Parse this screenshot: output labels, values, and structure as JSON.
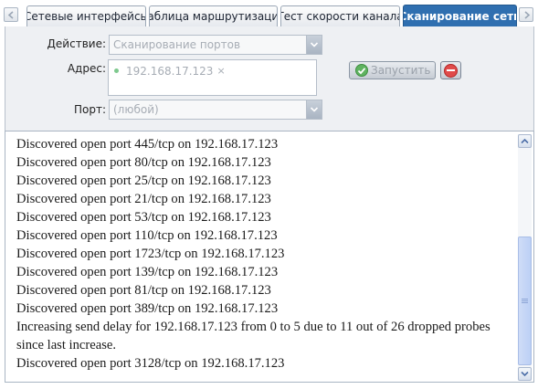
{
  "tabs": [
    {
      "label": "Сетевые интерфейсы",
      "active": false
    },
    {
      "label": "Таблица маршрутизации",
      "active": false
    },
    {
      "label": "Тест скорости канала",
      "active": false
    },
    {
      "label": "Сканирование сети",
      "active": true
    }
  ],
  "form": {
    "action_label": "Действие:",
    "action_value": "Сканирование портов",
    "address_label": "Адрес:",
    "address_chip": "192.168.17.123",
    "address_chip_remove": "×",
    "port_label": "Порт:",
    "port_value": "(любой)",
    "run_button": "Запустить"
  },
  "log": [
    "Discovered open port 445/tcp on 192.168.17.123",
    "Discovered open port 80/tcp on 192.168.17.123",
    "Discovered open port 25/tcp on 192.168.17.123",
    "Discovered open port 21/tcp on 192.168.17.123",
    "Discovered open port 53/tcp on 192.168.17.123",
    "Discovered open port 110/tcp on 192.168.17.123",
    "Discovered open port 1723/tcp on 192.168.17.123",
    "Discovered open port 139/tcp on 192.168.17.123",
    "Discovered open port 81/tcp on 192.168.17.123",
    "Discovered open port 389/tcp on 192.168.17.123",
    "Increasing send delay for 192.168.17.123 from 0 to 5 due to 11 out of 26 dropped probes since last increase.",
    "Discovered open port 3128/tcp on 192.168.17.123"
  ],
  "colors": {
    "active_tab": "#2f6fb0",
    "run_icon": "#5fb360",
    "stop_icon": "#e04b4b",
    "scroll_thumb": "#c4d5f5"
  },
  "icons": {
    "tabs_prev": "chevron-left-icon",
    "tabs_next": "chevron-right-icon",
    "combo_dropdown": "chevron-down-icon",
    "run": "check-circle-icon",
    "stop": "minus-circle-icon",
    "scroll_up": "chevron-up-icon",
    "scroll_down": "chevron-down-icon"
  }
}
